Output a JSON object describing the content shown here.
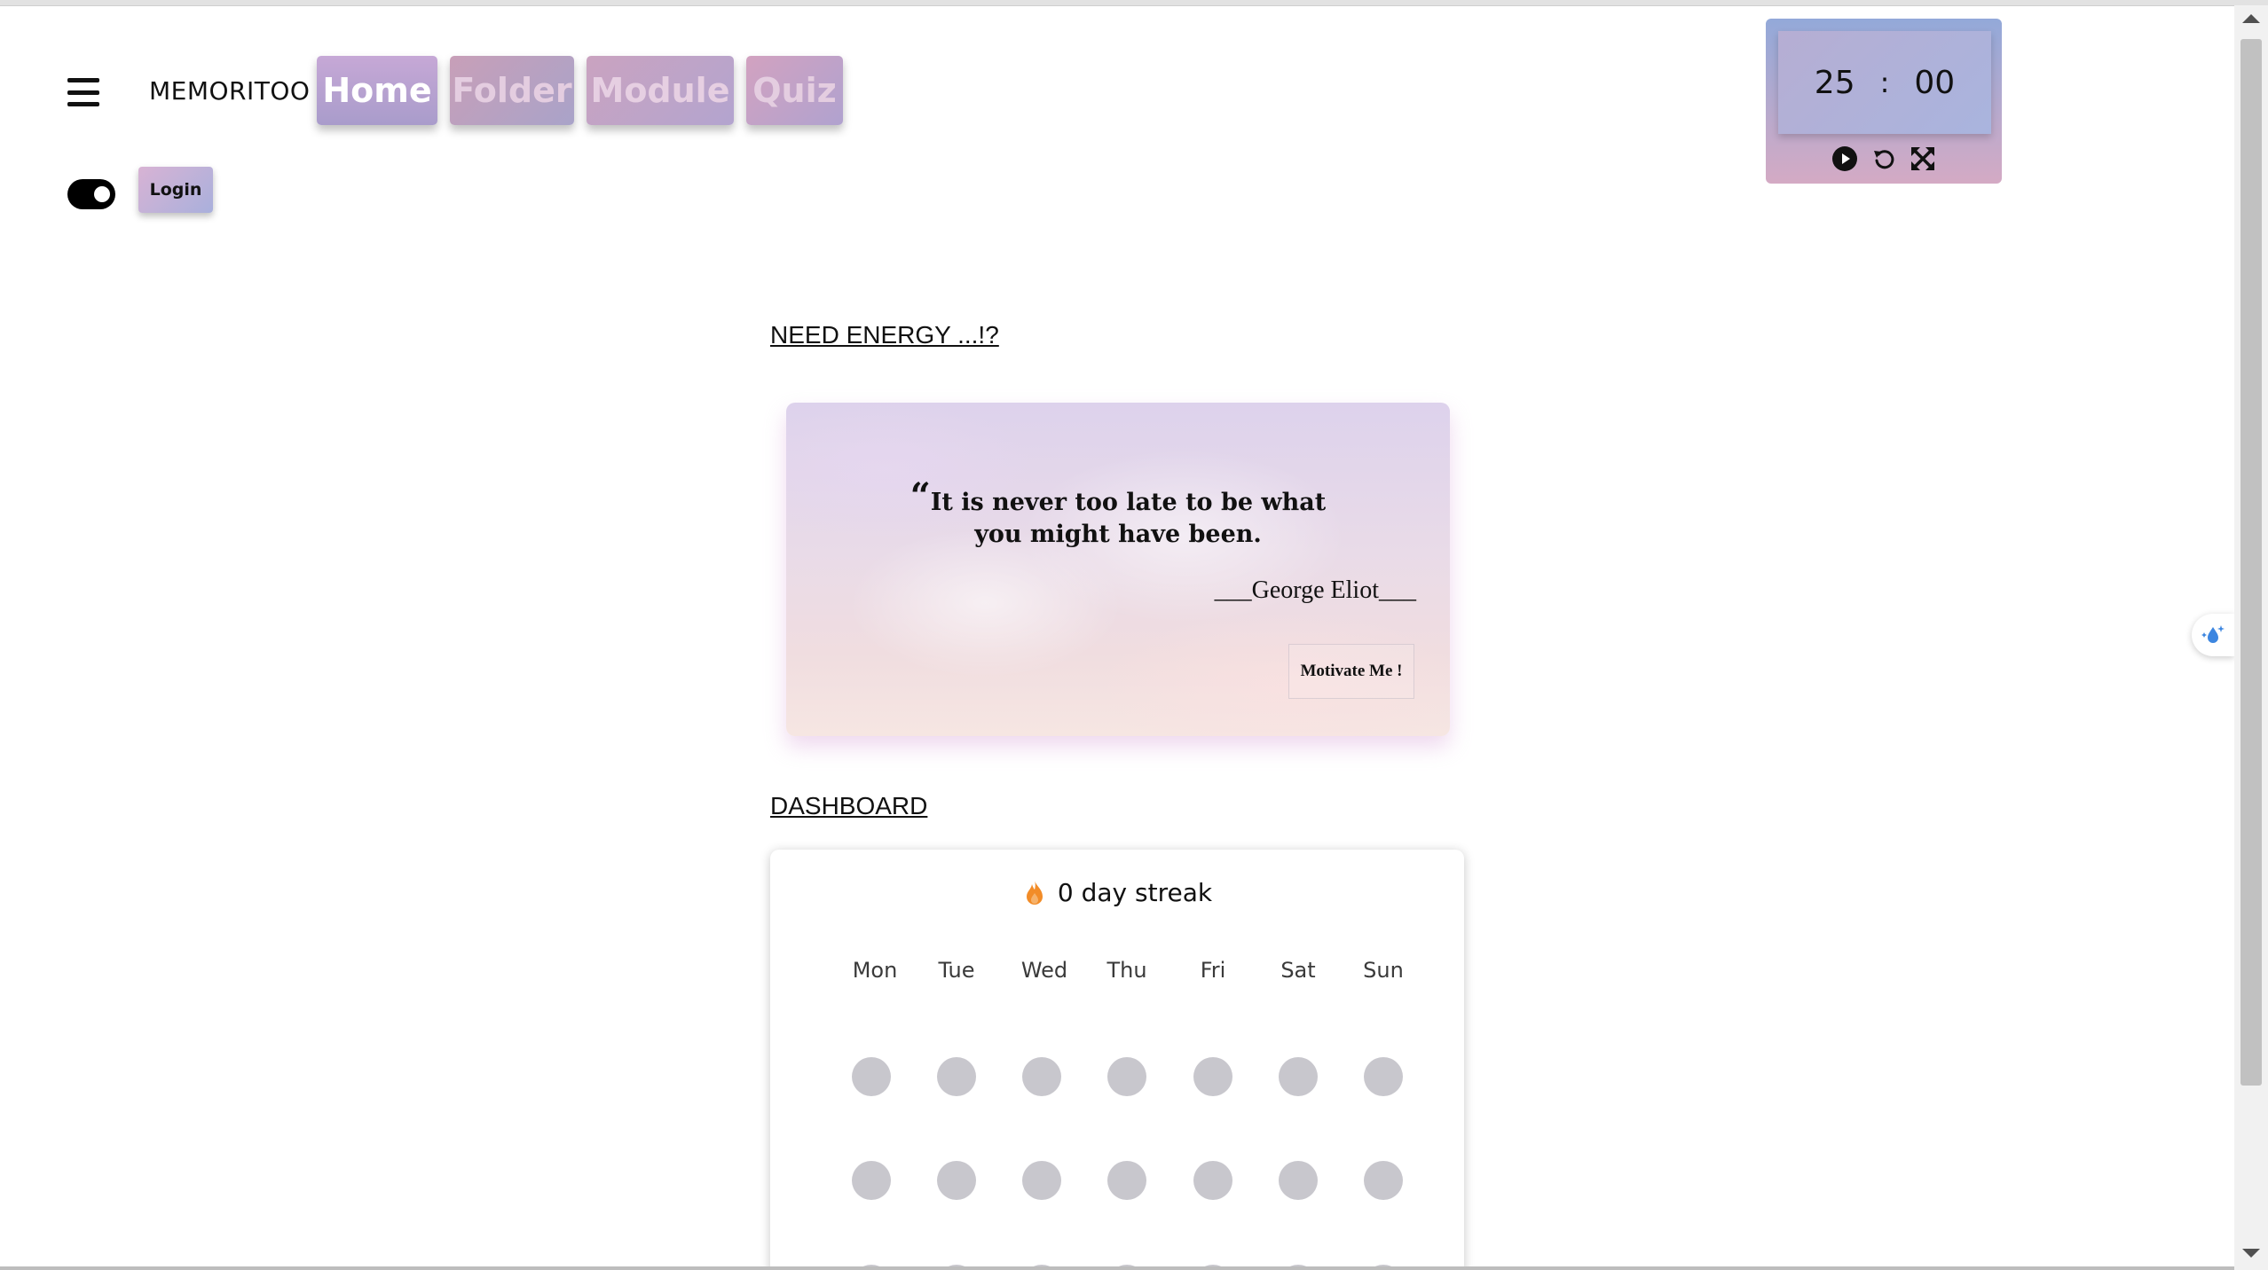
{
  "nav": {
    "brand": "MEMORITOO",
    "items": [
      {
        "label": "Home"
      },
      {
        "label": "Folder"
      },
      {
        "label": "Module"
      },
      {
        "label": "Quiz"
      }
    ],
    "login_label": "Login"
  },
  "timer": {
    "minutes": "25",
    "separator": ":",
    "seconds": "00",
    "controls": [
      "play-icon",
      "reset-icon",
      "fullscreen-icon"
    ]
  },
  "energy": {
    "heading": "NEED ENERGY ...!?",
    "quote_mark": "“",
    "quote": "It is never too late to be what you might have been.",
    "author": "___George Eliot___",
    "button_label": "Motivate Me !"
  },
  "dashboard": {
    "heading": "DASHBOARD",
    "streak": "0 day streak",
    "days": [
      "Mon",
      "Tue",
      "Wed",
      "Thu",
      "Fri",
      "Sat",
      "Sun"
    ]
  },
  "colors": {
    "dot_inactive": "#c8c7cd",
    "streak_fire": "#f28c28"
  }
}
